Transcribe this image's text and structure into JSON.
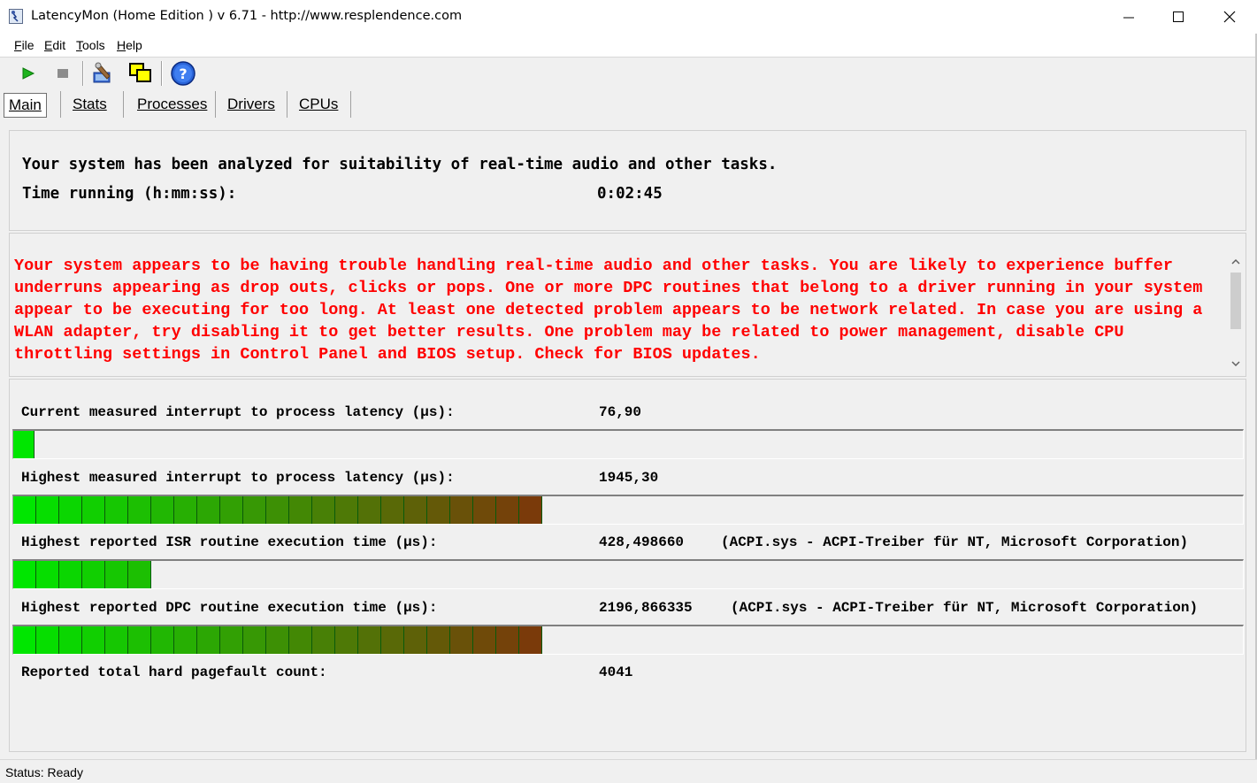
{
  "window": {
    "title": "LatencyMon  (Home Edition )  v 6.71 - http://www.resplendence.com",
    "minimize_icon": "minimize-icon",
    "maximize_icon": "maximize-icon",
    "close_icon": "close-icon"
  },
  "menu": {
    "items": [
      "File",
      "Edit",
      "Tools",
      "Help"
    ]
  },
  "toolbar": {
    "buttons": [
      "play-icon",
      "stop-icon",
      "wrench-icon",
      "copy-icon",
      "help-icon"
    ]
  },
  "tabs": [
    "Main",
    "Stats",
    "Processes",
    "Drivers",
    "CPUs"
  ],
  "active_tab": "Main",
  "summary": {
    "line1": "Your system has been analyzed for suitability of real-time audio and other tasks.",
    "time_label": "Time running (h:mm:ss):",
    "time_value": "0:02:45"
  },
  "warning": {
    "text": "Your system appears to be having trouble handling real-time audio and other tasks. You are likely to experience buffer underruns appearing as drop outs, clicks or pops. One or more DPC routines that belong to a driver running in your system appear to be executing for too long. At least one detected problem appears to be network related. In case you are using a WLAN adapter, try disabling it to get better results. One problem may be related to power management, disable CPU throttling settings in Control Panel and BIOS setup. Check for BIOS updates.",
    "color": "#ff0000"
  },
  "metrics": {
    "current": {
      "label": "Current measured interrupt to process latency (µs):",
      "value": "76,90",
      "bar_segments": 1
    },
    "highest": {
      "label": "Highest measured interrupt to process latency (µs):",
      "value": "1945,30",
      "bar_segments": 23
    },
    "isr": {
      "label": "Highest reported ISR routine execution time (µs):",
      "value": "428,498660",
      "extra": "(ACPI.sys - ACPI-Treiber für NT, Microsoft Corporation)",
      "bar_segments": 6
    },
    "dpc": {
      "label": "Highest reported DPC routine execution time (µs):",
      "value": "2196,866335",
      "extra": "(ACPI.sys - ACPI-Treiber für NT, Microsoft Corporation)",
      "bar_segments": 23
    },
    "pagefault": {
      "label": "Reported total hard pagefault count:",
      "value": "4041"
    }
  },
  "status": {
    "text": "Status: Ready"
  }
}
